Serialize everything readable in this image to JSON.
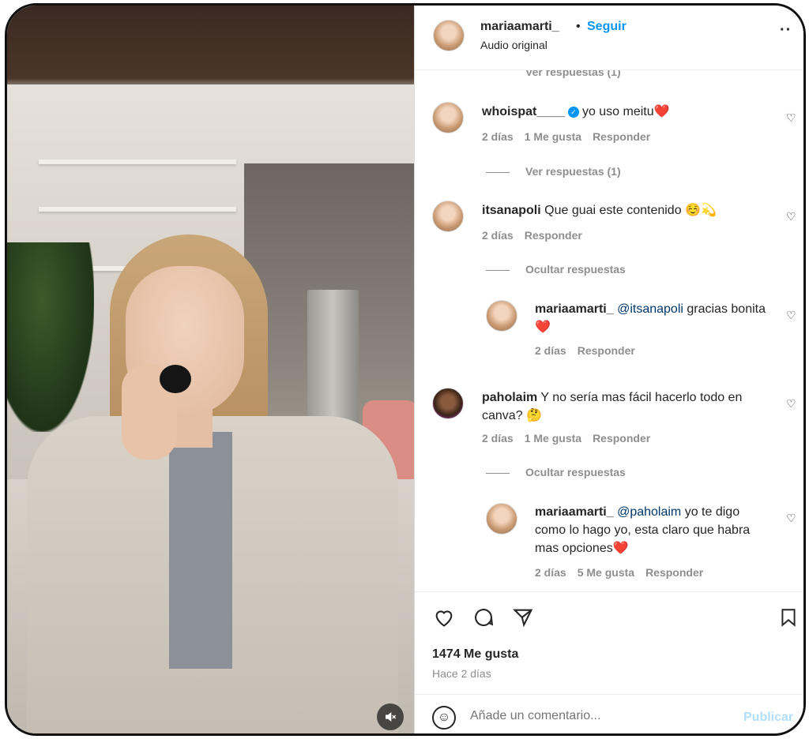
{
  "header": {
    "username": "mariaamarti_",
    "dot": "•",
    "follow_label": "Seguir",
    "subtitle": "Audio original",
    "more_icon": "more-horizontal-icon"
  },
  "comments_partial_top": "Ver respuestas (1)",
  "comments": [
    {
      "user": "whoispat____",
      "verified": true,
      "text": "yo uso meitu❤️",
      "time": "2 días",
      "likes": "1 Me gusta",
      "reply": "Responder",
      "replies_toggle": "Ver respuestas (1)"
    },
    {
      "user": "itsanapoli",
      "text": "Que guai este contenido ☺️💫",
      "time": "2 días",
      "reply": "Responder",
      "replies_toggle": "Ocultar respuestas",
      "replies": [
        {
          "user": "mariaamarti_",
          "mention": "@itsanapoli",
          "text": "gracias bonita❤️",
          "time": "2 días",
          "reply": "Responder"
        }
      ]
    },
    {
      "user": "paholaim",
      "text": "Y no sería mas fácil hacerlo todo en canva? 🤔",
      "time": "2 días",
      "likes": "1 Me gusta",
      "reply": "Responder",
      "replies_toggle": "Ocultar respuestas",
      "replies": [
        {
          "user": "mariaamarti_",
          "mention": "@paholaim",
          "text": "yo te digo como lo hago yo, esta claro que habra mas opciones❤️",
          "time": "2 días",
          "likes": "5 Me gusta",
          "reply": "Responder"
        }
      ]
    }
  ],
  "actions": {
    "like_icon": "heart-outline-icon",
    "comment_icon": "comment-icon",
    "share_icon": "send-icon",
    "save_icon": "bookmark-icon",
    "likes": "1474 Me gusta",
    "ago": "Hace 2 días"
  },
  "composer": {
    "emoji_icon": "emoji-icon",
    "placeholder": "Añade un comentario...",
    "publish": "Publicar"
  },
  "video": {
    "mute_icon": "muted-speaker-icon"
  }
}
